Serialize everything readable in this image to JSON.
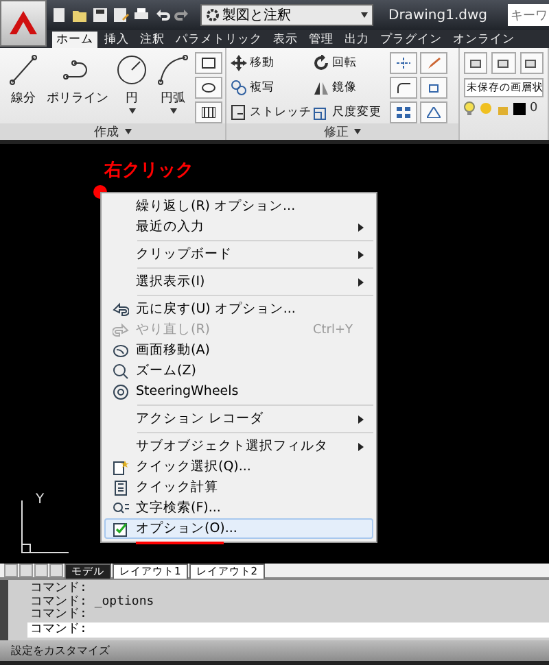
{
  "title_bar": {
    "workspace": "製図と注釈",
    "document": "Drawing1.dwg",
    "search": {
      "placeholder": "キーワ"
    }
  },
  "tabs": [
    {
      "label": "ホーム",
      "selected": true
    },
    {
      "label": "挿入",
      "selected": false
    },
    {
      "label": "注釈",
      "selected": false
    },
    {
      "label": "パラメトリック",
      "selected": false
    },
    {
      "label": "表示",
      "selected": false
    },
    {
      "label": "管理",
      "selected": false
    },
    {
      "label": "出力",
      "selected": false
    },
    {
      "label": "プラグイン",
      "selected": false
    },
    {
      "label": "オンライン",
      "selected": false
    }
  ],
  "ribbon": {
    "draw_panel": {
      "title": "作成",
      "tools": [
        {
          "kind": "line",
          "label": "線分",
          "dropdown": false
        },
        {
          "kind": "polyline",
          "label": "ポリライン",
          "dropdown": false
        },
        {
          "kind": "circle",
          "label": "円",
          "dropdown": true
        },
        {
          "kind": "arc",
          "label": "円弧",
          "dropdown": true
        }
      ]
    },
    "modify_panel": {
      "title": "修正",
      "tools": [
        {
          "kind": "move",
          "label": "移動"
        },
        {
          "kind": "rotate",
          "label": "回転"
        },
        {
          "kind": "copy",
          "label": "複写"
        },
        {
          "kind": "mirror",
          "label": "鏡像"
        },
        {
          "kind": "stretch",
          "label": "ストレッチ"
        },
        {
          "kind": "scale",
          "label": "尺度変更"
        }
      ]
    },
    "layer_panel": {
      "layer_state": "未保存の画層状",
      "layer": "0"
    }
  },
  "canvas": {
    "annotation": "右クリック"
  },
  "context_menu": [
    {
      "kind": "item",
      "label": "繰り返し(R) オプション...",
      "submenu": false,
      "disabled": false,
      "selected": false
    },
    {
      "kind": "item",
      "label": "最近の入力",
      "submenu": true,
      "disabled": false,
      "selected": false
    },
    {
      "kind": "separator"
    },
    {
      "kind": "item",
      "label": "クリップボード",
      "submenu": true,
      "disabled": false,
      "selected": false
    },
    {
      "kind": "separator"
    },
    {
      "kind": "item",
      "label": "選択表示(I)",
      "submenu": true,
      "disabled": false,
      "selected": false
    },
    {
      "kind": "separator"
    },
    {
      "kind": "item",
      "label": "元に戻す(U) オプション...",
      "submenu": false,
      "disabled": false,
      "selected": false
    },
    {
      "kind": "item",
      "label": "やり直し(R)",
      "shortcut": "Ctrl+Y",
      "submenu": false,
      "disabled": true,
      "selected": false
    },
    {
      "kind": "item",
      "label": "画面移動(A)",
      "submenu": false,
      "disabled": false,
      "selected": false
    },
    {
      "kind": "item",
      "label": "ズーム(Z)",
      "submenu": false,
      "disabled": false,
      "selected": false
    },
    {
      "kind": "item",
      "label": "SteeringWheels",
      "submenu": false,
      "disabled": false,
      "selected": false
    },
    {
      "kind": "separator"
    },
    {
      "kind": "item",
      "label": "アクション レコーダ",
      "submenu": true,
      "disabled": false,
      "selected": false
    },
    {
      "kind": "separator"
    },
    {
      "kind": "item",
      "label": "サブオブジェクト選択フィルタ",
      "submenu": true,
      "disabled": false,
      "selected": false
    },
    {
      "kind": "item",
      "label": "クイック選択(Q)...",
      "submenu": false,
      "disabled": false,
      "selected": false
    },
    {
      "kind": "item",
      "label": "クイック計算",
      "submenu": false,
      "disabled": false,
      "selected": false
    },
    {
      "kind": "item",
      "label": "文字検索(F)...",
      "submenu": false,
      "disabled": false,
      "selected": false
    },
    {
      "kind": "item",
      "label": "オプション(O)...",
      "submenu": false,
      "disabled": false,
      "selected": true
    }
  ],
  "ucs": {
    "y_label": "Y"
  },
  "layout_tabs": [
    {
      "label": "モデル",
      "selected": true
    },
    {
      "label": "レイアウト1",
      "selected": false
    },
    {
      "label": "レイアウト2",
      "selected": false
    }
  ],
  "command_history": [
    "コマンド:",
    "コマンド: _options",
    "コマンド:"
  ],
  "command_prompt": "コマンド:",
  "status_bar": "設定をカスタマイズ"
}
